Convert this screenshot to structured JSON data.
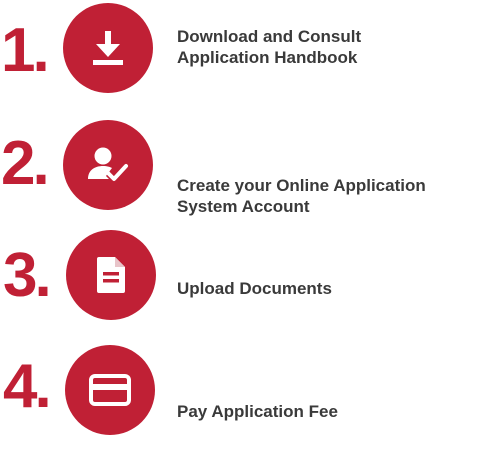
{
  "brand_color": "#c02035",
  "text_color": "#3a3a3a",
  "steps": [
    {
      "number": "1.",
      "icon": "download-icon",
      "label_lines": [
        "Download and Consult",
        "Application Handbook"
      ]
    },
    {
      "number": "2.",
      "icon": "user-check-icon",
      "label_lines": [
        "Create your Online Application",
        "System Account"
      ]
    },
    {
      "number": "3.",
      "icon": "document-icon",
      "label_lines": [
        "Upload Documents"
      ]
    },
    {
      "number": "4.",
      "icon": "credit-card-icon",
      "label_lines": [
        "Pay Application Fee"
      ]
    }
  ]
}
